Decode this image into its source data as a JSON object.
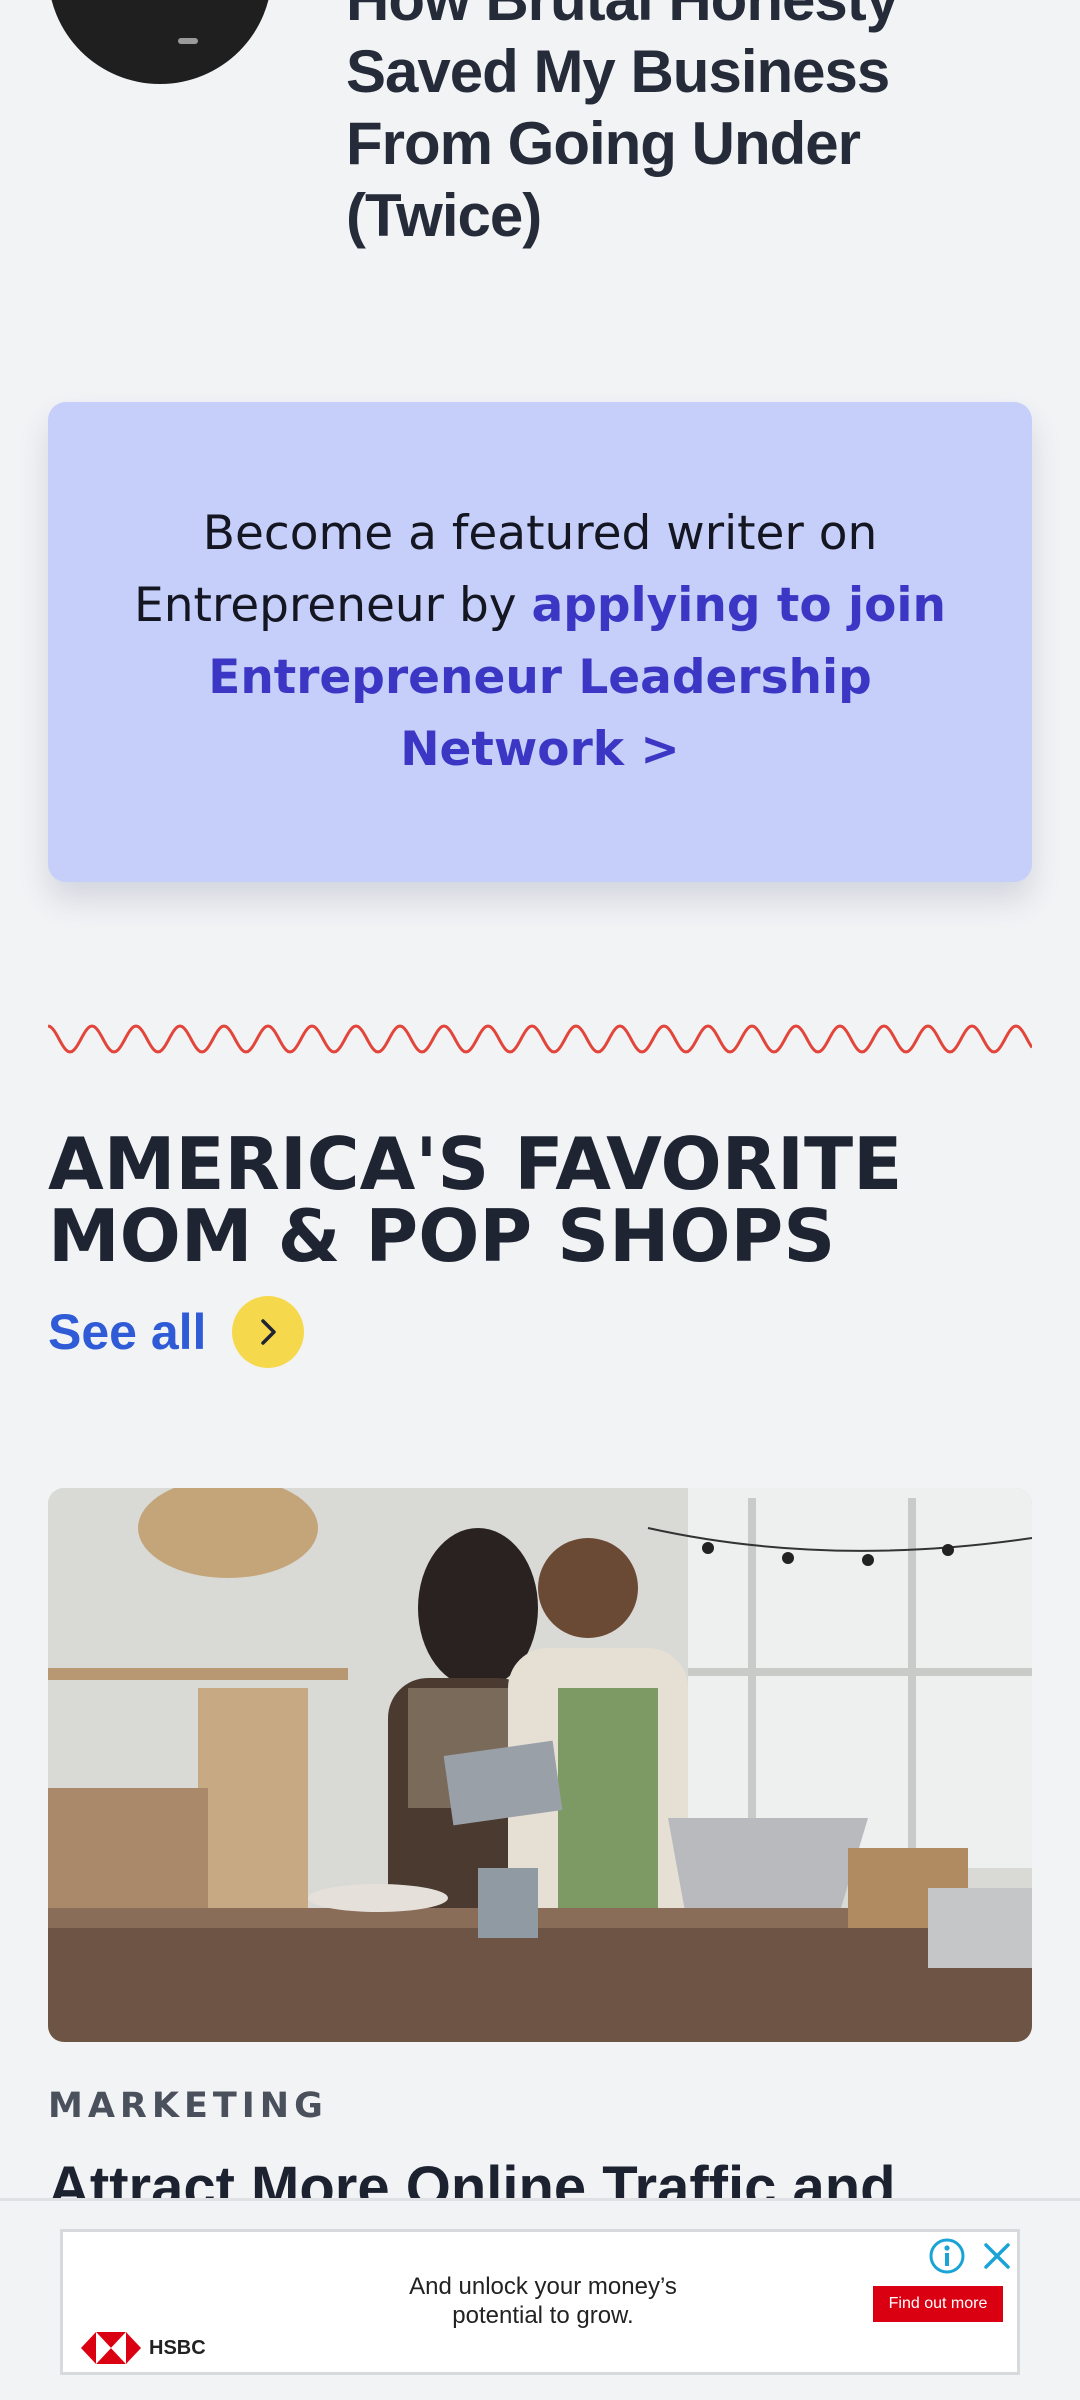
{
  "top_article": {
    "title": "How Brutal Honesty Saved My Business From Going Under (Twice)"
  },
  "promo": {
    "text_before": "Become a featured writer on Entrepreneur by ",
    "link_text": "applying to join Entrepreneur Leadership Network >"
  },
  "section": {
    "title": "AMERICA'S FAVORITE MOM & POP SHOPS",
    "see_all_label": "See all"
  },
  "feature": {
    "category": "MARKETING",
    "headline": "Attract More Online Traffic and"
  },
  "ad": {
    "text": "And unlock your money’s potential to grow.",
    "cta": "Find out more",
    "brand": "HSBC"
  },
  "colors": {
    "accent_blue": "#2f5bd6",
    "promo_bg": "#c5cffa",
    "promo_link": "#3b37c4",
    "see_all_circle": "#f6d84c",
    "wave_red": "#e2463a"
  },
  "icons": [
    "avatar-photo",
    "chevron-right-icon",
    "info-icon",
    "close-icon",
    "hsbc-logo-icon"
  ]
}
